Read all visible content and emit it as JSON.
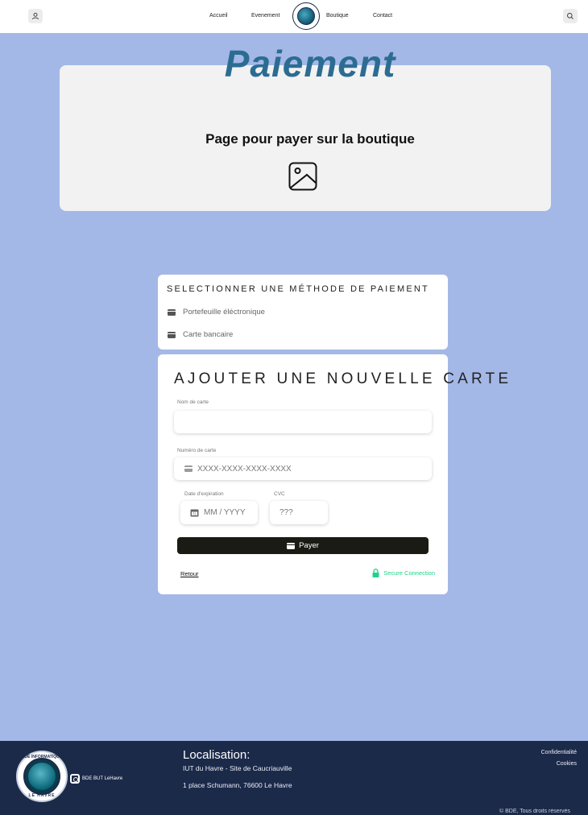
{
  "header": {
    "nav": [
      "Accueil",
      "Evenement",
      "Boutique",
      "Contact"
    ],
    "user_icon": "user-icon",
    "search_icon": "search-icon"
  },
  "hero": {
    "title": "Paiement",
    "subtitle": "Page pour payer sur la boutique",
    "image_icon": "image-placeholder-icon"
  },
  "payment_methods": {
    "title": "SELECTIONNER UNE MÉTHODE DE PAIEMENT",
    "items": [
      "Portefeuille éléctronique",
      "Carte bancaire"
    ]
  },
  "add_card": {
    "title": "AJOUTER UNE NOUVELLE CARTE",
    "name_label": "Nom de carte",
    "name_value": "",
    "number_label": "Numéro de carte",
    "number_placeholder": "XXXX-XXXX-XXXX-XXXX",
    "expiry_label": "Date d'expiration",
    "expiry_placeholder": "MM / YYYY",
    "cvc_label": "CVC",
    "cvc_placeholder": "???",
    "pay_label": "Payer",
    "back_label": "Retour",
    "secure_label": "Secure Connection"
  },
  "footer": {
    "logo_top": "BDE INFORMATIQUE",
    "logo_bottom": "LE HAVRE",
    "instagram": "BDE BUT LeHavre",
    "location_title": "Localisation:",
    "location_line1": "IUT du Havre - Site de Caucriauville",
    "location_line2": "1 place Schumann, 76600 Le Havre",
    "legal_links": [
      "Confidentialité",
      "Cookies"
    ],
    "copyright": "© BDE, Tous droits réservés"
  },
  "colors": {
    "page_bg": "#a3b8e6",
    "title": "#2c6c93",
    "footer_bg": "#1c2a4a",
    "secure": "#1fd38a",
    "button": "#191b14"
  }
}
